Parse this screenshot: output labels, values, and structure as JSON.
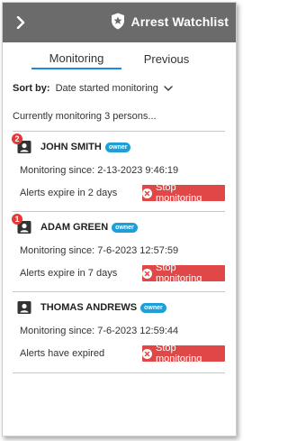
{
  "header": {
    "title": "Arrest Watchlist"
  },
  "tabs": [
    {
      "label": "Monitoring",
      "active": true
    },
    {
      "label": "Previous",
      "active": false
    }
  ],
  "sort": {
    "label": "Sort by:",
    "value": "Date started monitoring"
  },
  "status_text": "Currently monitoring 3 persons...",
  "persons": [
    {
      "name": "JOHN SMITH",
      "tag": "owner",
      "alert_count": "2",
      "since": "Monitoring since: 2-13-2023 9:46:19",
      "expiry": "Alerts expire in 2 days",
      "action": "Stop monitoring"
    },
    {
      "name": "ADAM GREEN",
      "tag": "owner",
      "alert_count": "1",
      "since": "Monitoring since: 7-6-2023 12:57:59",
      "expiry": "Alerts expire in 7 days",
      "action": "Stop monitoring"
    },
    {
      "name": "THOMAS ANDREWS",
      "tag": "owner",
      "since": "Monitoring since: 7-6-2023 12:59:44",
      "expiry": "Alerts have expired",
      "action": "Stop monitoring"
    }
  ],
  "colors": {
    "header_bg": "#6b6b6b",
    "accent": "#1e88e5",
    "owner_badge": "#1e9fd8",
    "stop_button": "#e04848",
    "alert_badge": "#e53935"
  },
  "icons": {
    "back": "chevron-right-icon",
    "shield": "shield-star-icon",
    "sort": "chevron-down-icon",
    "person": "person-card-icon",
    "stop": "close-circle-icon"
  }
}
